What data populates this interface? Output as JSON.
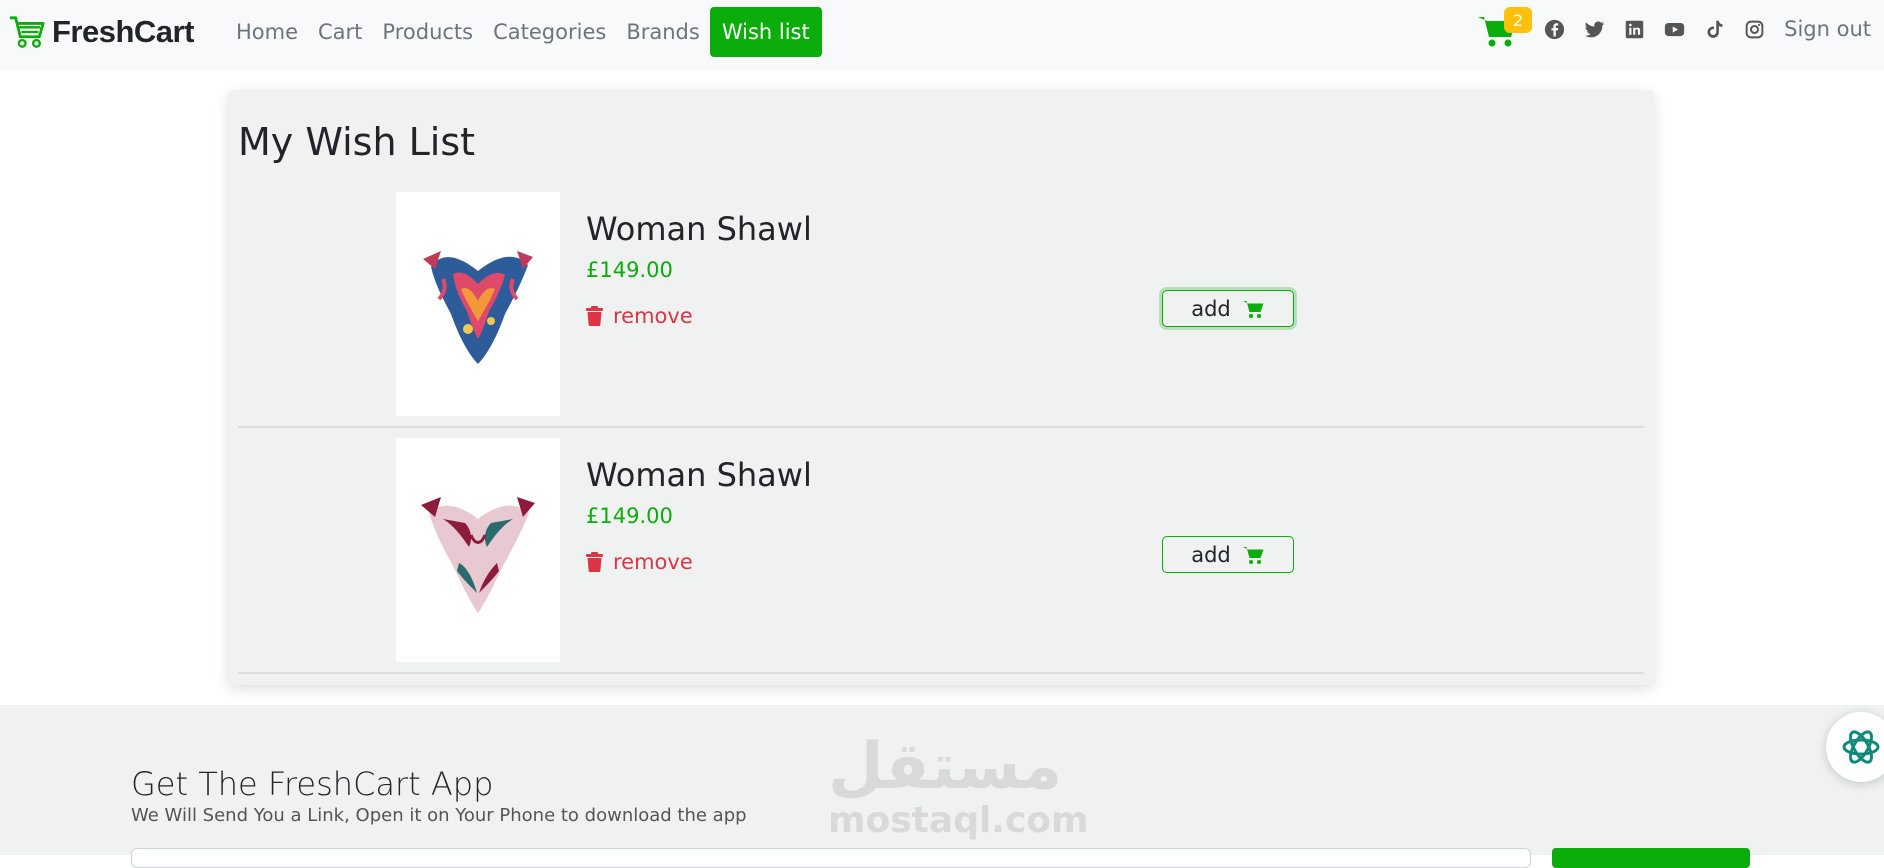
{
  "brand": {
    "name": "FreshCart",
    "color": "#0aad0a"
  },
  "nav": {
    "links": [
      "Home",
      "Cart",
      "Products",
      "Categories",
      "Brands",
      "Wish list"
    ],
    "active": "Wish list",
    "cart_count": "2",
    "social_icons": [
      "facebook-icon",
      "twitter-icon",
      "linkedin-icon",
      "youtube-icon",
      "tiktok-icon",
      "instagram-icon"
    ],
    "signout": "Sign out"
  },
  "wishlist": {
    "title": "My Wish List",
    "items": [
      {
        "name": "Woman Shawl",
        "price": "£149.00",
        "remove_label": "remove",
        "add_label": "add"
      },
      {
        "name": "Woman Shawl",
        "price": "£149.00",
        "remove_label": "remove",
        "add_label": "add"
      }
    ]
  },
  "footer": {
    "title": "Get The FreshCart App",
    "subtitle": "We Will Send You a Link, Open it on Your Phone to download the app",
    "watermark_ar": "مستقل",
    "watermark_en": "mostaql.com"
  },
  "colors": {
    "accent": "#0aad0a",
    "danger": "#dc3545",
    "badge": "#ffc107"
  }
}
